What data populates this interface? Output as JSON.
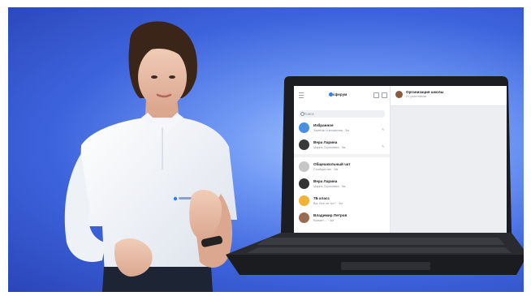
{
  "app": {
    "brand": "сферум",
    "search_placeholder": "Поиск"
  },
  "chats": [
    {
      "name": "Избранное",
      "preview": "Заметки и вложения · 5м",
      "avatar_color": "#4a90e2",
      "pinned": true
    },
    {
      "name": "Вера Ларина",
      "preview": "Мария Сергеевна · 5м",
      "avatar_color": "#3a3a3a",
      "pinned": true
    },
    {
      "name": "Общешкольный чат",
      "preview": "Сообщество · 5м",
      "avatar_color": "#c7c7c7",
      "pinned": false
    },
    {
      "name": "Вера Ларина",
      "preview": "Мария Сергеевна · 5м",
      "avatar_color": "#333333",
      "pinned": false
    },
    {
      "name": "7Б класс",
      "preview": "Вы: Все ли тут? · 5м",
      "avatar_color": "#f2b233",
      "pinned": false
    },
    {
      "name": "Владимир Петров",
      "preview": "Бывает… · 5м",
      "avatar_color": "#9b6b4f",
      "pinned": false
    }
  ],
  "open_chat": {
    "title": "Организация школы",
    "subtitle": "21 участников"
  },
  "colors": {
    "background_light": "#a9c8ff",
    "background_dark": "#2a45b8",
    "accent": "#2d7ff9"
  }
}
